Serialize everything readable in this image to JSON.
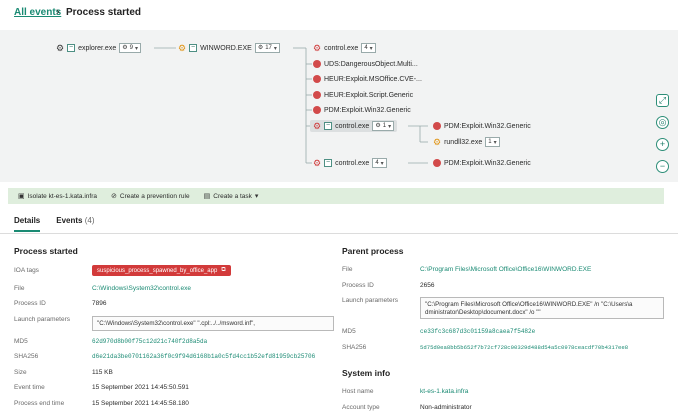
{
  "breadcrumb": {
    "root": "All events",
    "separator": "›",
    "current": "Process started"
  },
  "tree": {
    "explorer": {
      "name": "explorer.exe",
      "count": "9"
    },
    "winword": {
      "name": "WINWORD.EXE",
      "count": "17"
    },
    "control_top": {
      "name": "control.exe",
      "count": "4"
    },
    "uds": {
      "name": "UDS:DangerousObject.Multi..."
    },
    "heur_mso": {
      "name": "HEUR:Exploit.MSOffice.CVE-..."
    },
    "heur_script": {
      "name": "HEUR:Exploit.Script.Generic"
    },
    "pdm_win32": {
      "name": "PDM:Exploit.Win32.Generic"
    },
    "control_selected": {
      "name": "control.exe",
      "count": "1"
    },
    "pdm_child1": {
      "name": "PDM:Exploit.Win32.Generic"
    },
    "rundll": {
      "name": "rundll32.exe",
      "count": "1"
    },
    "control_bottom": {
      "name": "control.exe",
      "count": "4"
    },
    "pdm_child2": {
      "name": "PDM:Exploit.Win32.Generic"
    }
  },
  "actions": {
    "isolate": "Isolate kt-es-1.kata.infra",
    "prevention": "Create a prevention rule",
    "task": "Create a task"
  },
  "tabs": {
    "details": "Details",
    "events": "Events",
    "events_count": "(4)"
  },
  "process_started": {
    "title": "Process started",
    "labels": {
      "ioa": "IOA tags",
      "file": "File",
      "pid": "Process ID",
      "params": "Launch parameters",
      "md5": "MD5",
      "sha256": "SHA256",
      "size": "Size",
      "event_time": "Event time",
      "process_end": "Process end time"
    },
    "ioa_tag": "suspicious_process_spawned_by_office_app",
    "file": "C:\\Windows\\System32\\control.exe",
    "pid": "7896",
    "params": "\"C:\\Windows\\System32\\control.exe\" \".cpl:../../msword.inf\",",
    "md5": "62d970d8b00f75c12d21c740f2d8a5da",
    "sha256": "d6e21da3be0701162a36f0c9f94d6168b1a0c5fd4cc1b52efd81959cb25706",
    "size": "115 KB",
    "event_time": "15 September 2021 14:45:50.591",
    "process_end": "15 September 2021 14:45:58.180"
  },
  "parent_process": {
    "title": "Parent process",
    "labels": {
      "file": "File",
      "pid": "Process ID",
      "params": "Launch parameters",
      "md5": "MD5",
      "sha256": "SHA256"
    },
    "file": "C:\\Program Files\\Microsoft Office\\Office16\\WINWORD.EXE",
    "pid": "2656",
    "params_line1": "\"C:\\Program Files\\Microsoft Office\\Office16\\WINWORD.EXE\" /n \"C:\\Users\\a",
    "params_line2": "dministrator\\Desktop\\document.docx\" /o \"\"",
    "md5": "ce33fc3c687d3c01159a8caea7f5482e",
    "sha256": "5d75d0ea8bb5b652f7b72cf728c00329d488d54a5c0978ceacdf70b4317ee8"
  },
  "system_info": {
    "title": "System info",
    "labels": {
      "host": "Host name",
      "account": "Account type"
    },
    "host": "kt-es-1.kata.infra",
    "account": "Non-administrator"
  },
  "icons": {
    "gear": "⚙",
    "chevron": "▾",
    "collapse": "−",
    "external": "⧉"
  },
  "colors": {
    "accent": "#1a8a73",
    "danger": "#d23a3a",
    "warning": "#e09414"
  }
}
